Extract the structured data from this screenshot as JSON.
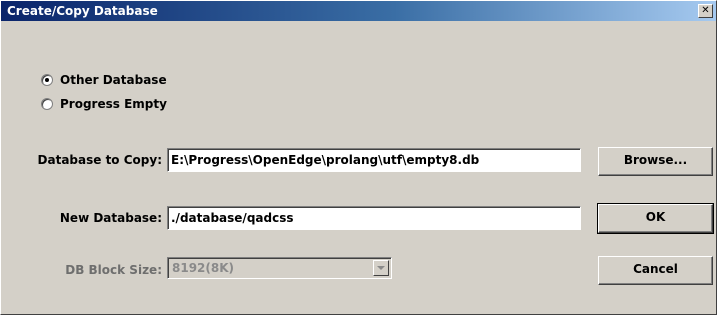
{
  "window": {
    "title": "Create/Copy Database",
    "close_glyph": "✕"
  },
  "source_options": {
    "items": [
      {
        "label": "Other Database",
        "checked": true
      },
      {
        "label": "Progress Empty",
        "checked": false
      }
    ]
  },
  "form": {
    "copy_label": "Database to Copy:",
    "copy_value": "E:\\Progress\\OpenEdge\\prolang\\utf\\empty8.db",
    "new_label": "New Database:",
    "new_value": "./database/qadcss",
    "block_label": "DB Block Size:",
    "block_value": "8192(8K)"
  },
  "buttons": {
    "browse": "Browse...",
    "ok": "OK",
    "cancel": "Cancel"
  },
  "colors": {
    "title_start": "#0a246a",
    "title_end": "#a6caf0",
    "face": "#d4d0c8"
  }
}
